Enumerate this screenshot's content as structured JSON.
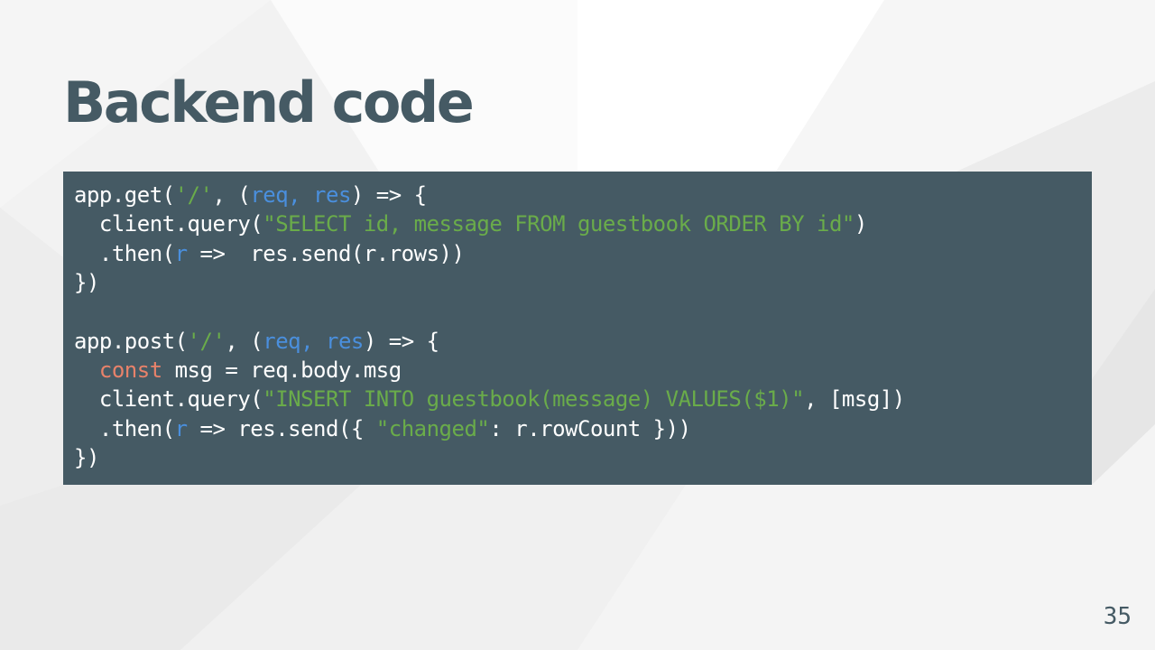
{
  "slide": {
    "title": "Backend code",
    "page_number": "35"
  },
  "colors": {
    "title": "#455a64",
    "code_background": "#455a64",
    "code_text": "#ffffff",
    "string": "#6aac4a",
    "parameter": "#4a8fdd",
    "keyword": "#e8826a"
  },
  "code": {
    "language": "javascript",
    "lines": [
      [
        [
          "t",
          "app.get("
        ],
        [
          "s",
          "'/'"
        ],
        [
          "t",
          ", ("
        ],
        [
          "p",
          "req, res"
        ],
        [
          "t",
          ") => {"
        ]
      ],
      [
        [
          "t",
          "  client.query("
        ],
        [
          "s",
          "\"SELECT id, message FROM guestbook ORDER BY id\""
        ],
        [
          "t",
          ")"
        ]
      ],
      [
        [
          "t",
          "  .then("
        ],
        [
          "p",
          "r"
        ],
        [
          "t",
          " =>  res.send(r.rows))"
        ]
      ],
      [
        [
          "t",
          "})"
        ]
      ],
      [
        [
          "t",
          ""
        ]
      ],
      [
        [
          "t",
          "app.post("
        ],
        [
          "s",
          "'/'"
        ],
        [
          "t",
          ", ("
        ],
        [
          "p",
          "req, res"
        ],
        [
          "t",
          ") => {"
        ]
      ],
      [
        [
          "t",
          "  "
        ],
        [
          "k",
          "const"
        ],
        [
          "t",
          " msg = req.body.msg"
        ]
      ],
      [
        [
          "t",
          "  client.query("
        ],
        [
          "s",
          "\"INSERT INTO guestbook(message) VALUES($1)\""
        ],
        [
          "t",
          ", [msg])"
        ]
      ],
      [
        [
          "t",
          "  .then("
        ],
        [
          "p",
          "r"
        ],
        [
          "t",
          " => res.send({ "
        ],
        [
          "s",
          "\"changed\""
        ],
        [
          "t",
          ": r.rowCount }))"
        ]
      ],
      [
        [
          "t",
          "})"
        ]
      ]
    ]
  }
}
